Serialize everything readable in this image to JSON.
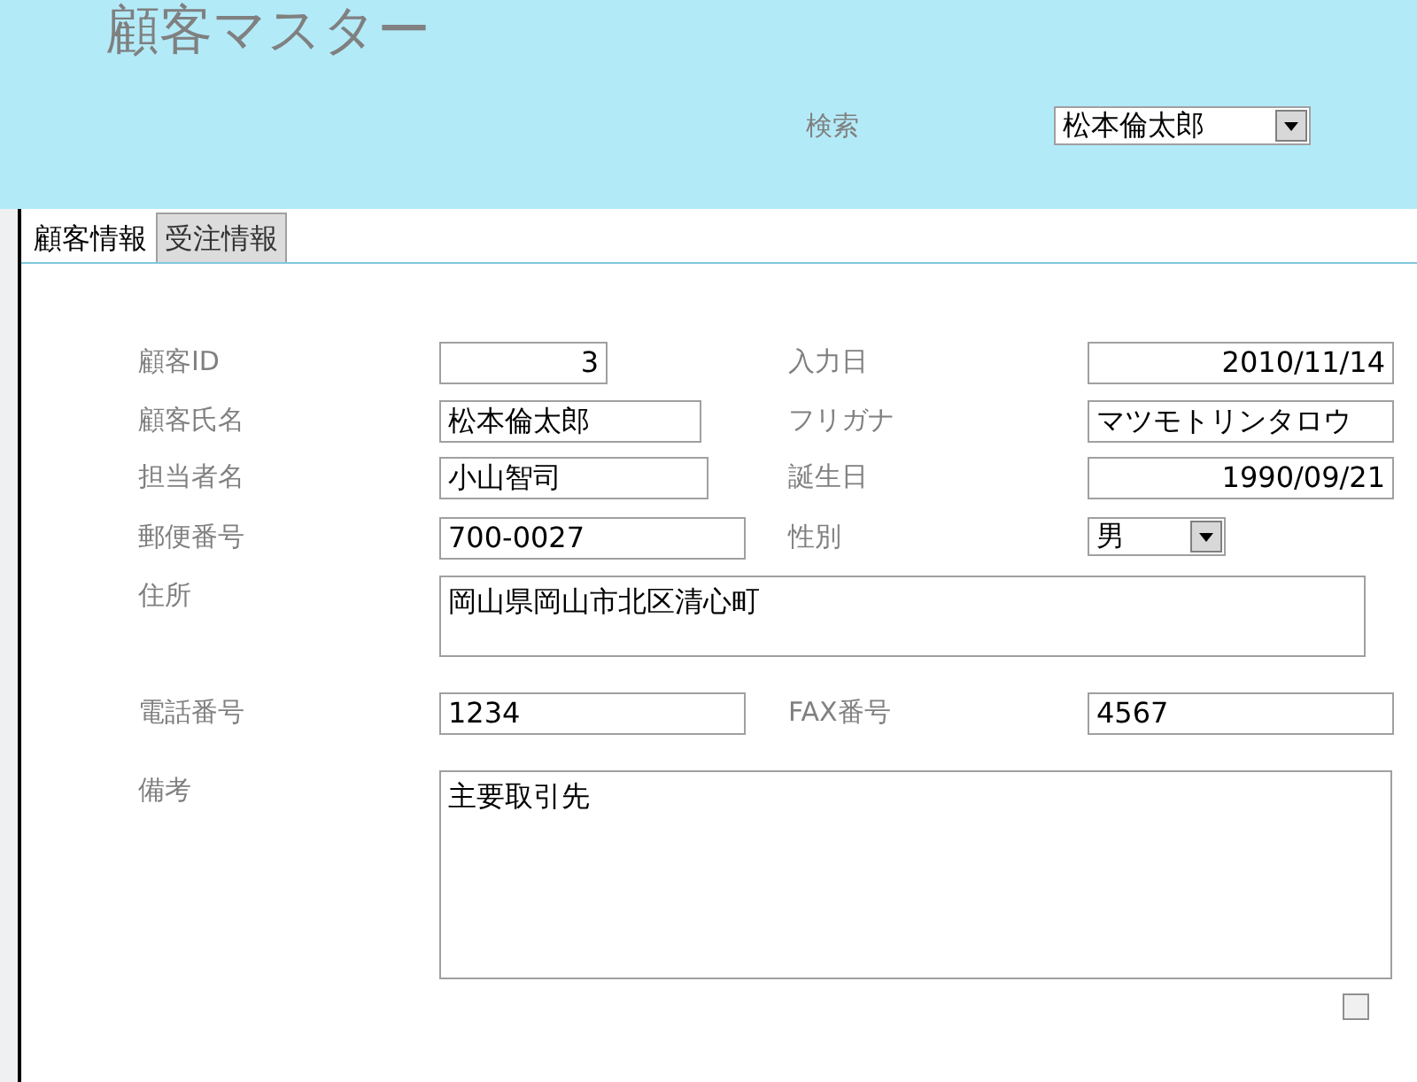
{
  "header": {
    "title": "顧客マスター",
    "search": {
      "label": "検索",
      "value": "松本倫太郎"
    }
  },
  "tabs": [
    {
      "label": "顧客情報",
      "selected": true
    },
    {
      "label": "受注情報",
      "selected": false
    }
  ],
  "rows": [
    {
      "fields": [
        {
          "label": "顧客ID",
          "value": "3",
          "kind": "text"
        },
        {
          "label": "入力日",
          "value": "2010/11/14",
          "kind": "text"
        }
      ]
    },
    {
      "fields": [
        {
          "label": "顧客氏名",
          "value": "松本倫太郎",
          "kind": "text"
        },
        {
          "label": "フリガナ",
          "value": "マツモトリンタロウ",
          "kind": "text"
        }
      ]
    },
    {
      "fields": [
        {
          "label": "担当者名",
          "value": "小山智司",
          "kind": "text"
        },
        {
          "label": "誕生日",
          "value": "1990/09/21",
          "kind": "text"
        }
      ]
    },
    {
      "fields": [
        {
          "label": "郵便番号",
          "value": "700-0027",
          "kind": "text"
        },
        {
          "label": "性別",
          "value": "男",
          "kind": "combo"
        }
      ]
    },
    {
      "fields": [
        {
          "label": "住所",
          "value": "岡山県岡山市北区清心町",
          "kind": "area"
        }
      ]
    },
    {
      "fields": [
        {
          "label": "電話番号",
          "value": "1234",
          "kind": "text"
        },
        {
          "label": "FAX番号",
          "value": "4567",
          "kind": "text"
        }
      ]
    },
    {
      "fields": [
        {
          "label": "備考",
          "value": "主要取引先",
          "kind": "memo"
        }
      ]
    }
  ],
  "checkbox": {
    "checked": false
  }
}
